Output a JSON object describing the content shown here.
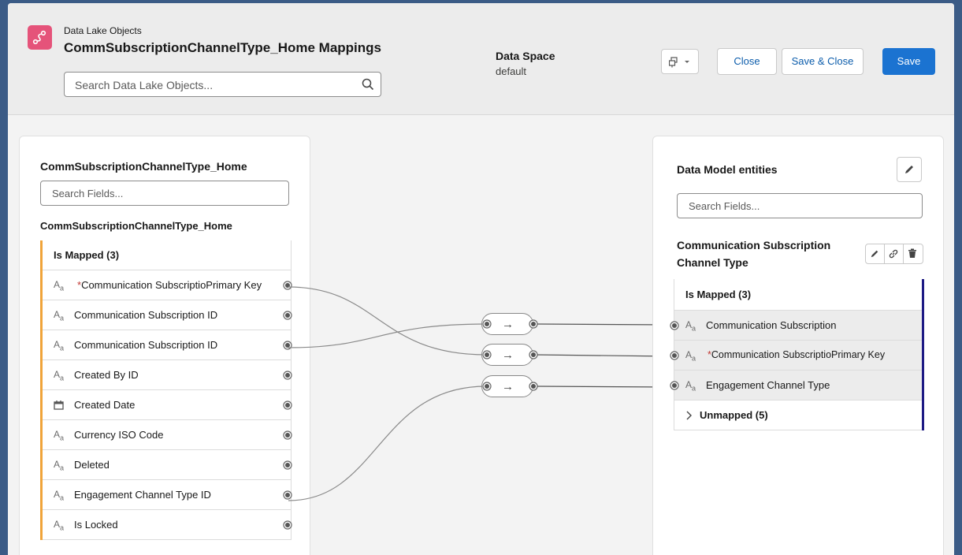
{
  "header": {
    "subtitle": "Data Lake Objects",
    "title": "CommSubscriptionChannelType_Home Mappings",
    "search_placeholder": "Search Data Lake Objects...",
    "data_space_label": "Data Space",
    "data_space_value": "default",
    "close_label": "Close",
    "save_close_label": "Save & Close",
    "save_label": "Save"
  },
  "left": {
    "title": "CommSubscriptionChannelType_Home",
    "search_placeholder": "Search Fields...",
    "object_label": "CommSubscriptionChannelType_Home",
    "group_label": "Is Mapped (3)",
    "fields": [
      {
        "label": "Communication Subscriptio",
        "suffix": "Primary Key",
        "required": true,
        "icon": "text-type-icon"
      },
      {
        "label": "Communication Subscription ID",
        "suffix": "",
        "required": false,
        "icon": "text-type-icon"
      },
      {
        "label": "Communication Subscription ID",
        "suffix": "",
        "required": false,
        "icon": "text-type-icon"
      },
      {
        "label": "Created By ID",
        "suffix": "",
        "required": false,
        "icon": "text-type-icon"
      },
      {
        "label": "Created Date",
        "suffix": "",
        "required": false,
        "icon": "calendar-icon"
      },
      {
        "label": "Currency ISO Code",
        "suffix": "",
        "required": false,
        "icon": "text-type-icon"
      },
      {
        "label": "Deleted",
        "suffix": "",
        "required": false,
        "icon": "text-type-icon"
      },
      {
        "label": "Engagement Channel Type ID",
        "suffix": "",
        "required": false,
        "icon": "text-type-icon"
      },
      {
        "label": "Is Locked",
        "suffix": "",
        "required": false,
        "icon": "text-type-icon"
      }
    ]
  },
  "right": {
    "title": "Data Model entities",
    "search_placeholder": "Search Fields...",
    "object_label_line1": "Communication Subscription",
    "object_label_line2": "Channel Type",
    "mapped_group_label": "Is Mapped (3)",
    "fields": [
      {
        "label": "Communication Subscription",
        "suffix": "",
        "required": false
      },
      {
        "label": "Communication Subscriptio",
        "suffix": "Primary Key",
        "required": true
      },
      {
        "label": "Engagement Channel Type",
        "suffix": "",
        "required": false
      }
    ],
    "unmapped_group_label": "Unmapped (5)"
  },
  "connector_symbol": "→",
  "colors": {
    "save_button": "#1b73d1",
    "link_text": "#0b5cab",
    "mapped_accent_left": "#f0a43a",
    "mapped_accent_right": "#1d1a84",
    "app_icon": "#e5537a",
    "required_star": "#c23934"
  }
}
